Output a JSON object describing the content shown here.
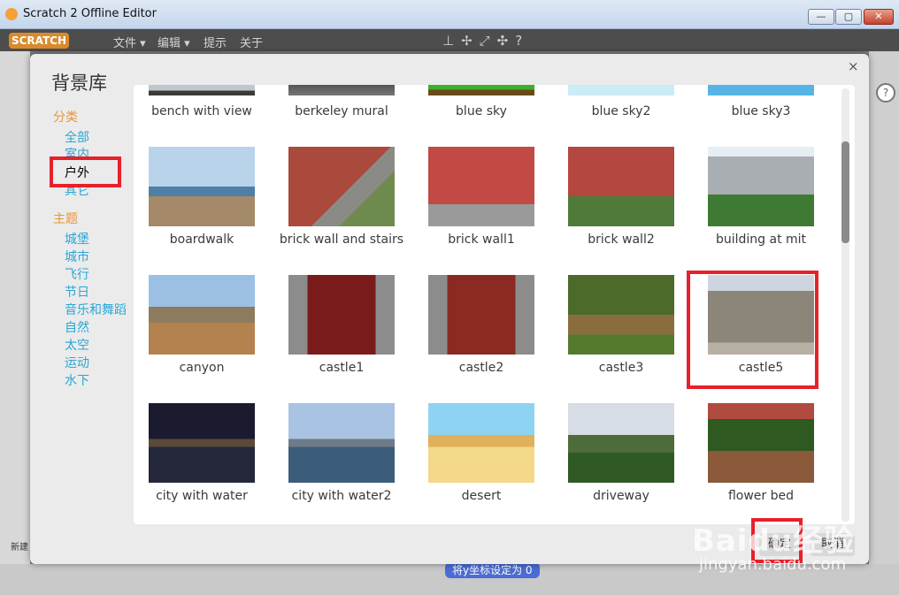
{
  "window": {
    "title": "Scratch 2 Offline Editor"
  },
  "menubar": {
    "logo": "SCRATCH",
    "items": [
      "文件 ▾",
      "编辑 ▾",
      "提示",
      "关于"
    ]
  },
  "dialog": {
    "title": "背景库",
    "close": "×",
    "category_heading": "分类",
    "categories": [
      "全部",
      "室内",
      "户外",
      "其它"
    ],
    "selected_category": "户外",
    "theme_heading": "主题",
    "themes": [
      "城堡",
      "城市",
      "飞行",
      "节日",
      "音乐和舞蹈",
      "自然",
      "太空",
      "运动",
      "水下"
    ],
    "ok_label": "确定",
    "cancel_label": "取消"
  },
  "backdrops": [
    "bench with view",
    "berkeley mural",
    "blue sky",
    "blue sky2",
    "blue sky3",
    "boardwalk",
    "brick wall and stairs",
    "brick wall1",
    "brick wall2",
    "building at mit",
    "canyon",
    "castle1",
    "castle2",
    "castle3",
    "castle5",
    "city with water",
    "city with water2",
    "desert",
    "driveway",
    "flower bed"
  ],
  "selected_backdrop": "castle5",
  "background": {
    "partial_block": "将y坐标设定为 0",
    "new_sprite": "新建"
  },
  "watermark": {
    "brand": "Baidu经验",
    "url": "jingyan.baidu.com"
  },
  "colors": {
    "accent_orange": "#e8963a",
    "link_blue": "#2aa6d6",
    "highlight_red": "#e8202a"
  }
}
